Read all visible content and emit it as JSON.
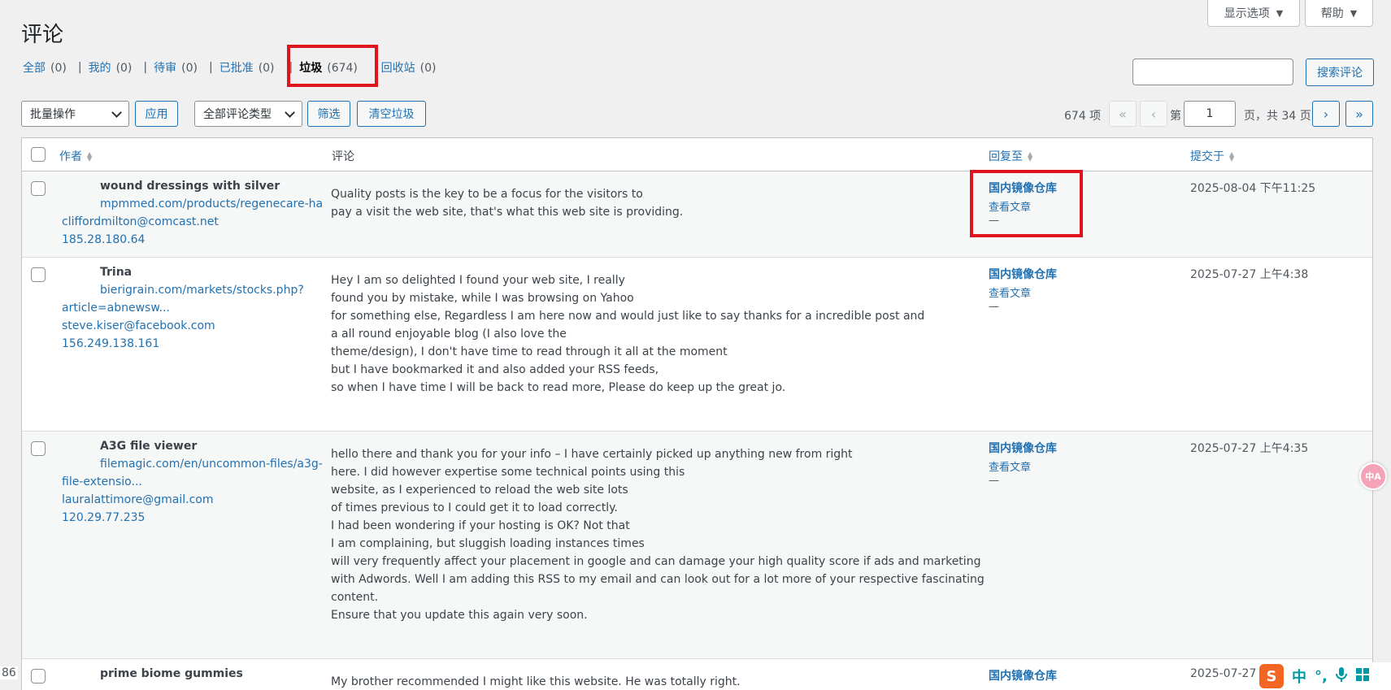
{
  "header": {
    "title": "评论",
    "screen_options": "显示选项",
    "help": "帮助"
  },
  "filters": [
    {
      "label": "全部",
      "count": "(0)"
    },
    {
      "label": "我的",
      "count": "(0)"
    },
    {
      "label": "待审",
      "count": "(0)"
    },
    {
      "label": "已批准",
      "count": "(0)"
    },
    {
      "label": "垃圾",
      "count": "(674)"
    },
    {
      "label": "回收站",
      "count": "(0)"
    }
  ],
  "search": {
    "value": "",
    "button": "搜索评论"
  },
  "tablenav": {
    "bulk_action": "批量操作",
    "apply": "应用",
    "comment_type": "全部评论类型",
    "filter": "筛选",
    "empty_spam": "清空垃圾",
    "items_count": "674 项",
    "first": "«",
    "prev": "‹",
    "page_prefix": "第",
    "current_page": "1",
    "page_suffix": "页，共 34 页",
    "next": "›",
    "last": "»"
  },
  "columns": {
    "author": "作者",
    "comment": "评论",
    "response": "回复至",
    "submitted": "提交于"
  },
  "rows": [
    {
      "author": "wound dressings with silver",
      "url": "mpmmed.com/products/regenecare-ha",
      "email": "cliffordmilton@comcast.net",
      "ip": "185.28.180.64",
      "comment": [
        "Quality posts is the key to be a focus for the visitors to",
        "pay a visit the web site, that's what this web site is providing."
      ],
      "response_title": "国内镜像仓库",
      "response_view": "查看文章",
      "response_dash": "—",
      "date": "2025-08-04 下午11:25"
    },
    {
      "author": "Trina",
      "url": "bierigrain.com/markets/stocks.php?",
      "url2": "article=abnewsw...",
      "email": "steve.kiser@facebook.com",
      "ip": "156.249.138.161",
      "comment": [
        "Hey I am so delighted I found your web site, I really",
        "found you by mistake, while I was browsing on Yahoo",
        "for something else, Regardless I am here now and would just like to say thanks for a incredible post and",
        "a all round enjoyable blog (I also love the",
        "theme/design), I don't have time to read through it all at the moment",
        "but I have bookmarked it and also added your RSS feeds,",
        "so when I have time I will be back to read more, Please do keep up the great jo."
      ],
      "response_title": "国内镜像仓库",
      "response_view": "查看文章",
      "response_dash": "—",
      "date": "2025-07-27 上午4:38"
    },
    {
      "author": "A3G file viewer",
      "url": "filemagic.com/en/uncommon-files/a3g-",
      "url2": "file-extensio...",
      "email": "lauralattimore@gmail.com",
      "ip": "120.29.77.235",
      "comment": [
        "hello there and thank you for your info – I have certainly picked up anything new from right",
        "here. I did however expertise some technical points using this",
        "website, as I experienced to reload the web site lots",
        "of times previous to I could get it to load correctly.",
        "I had been wondering if your hosting is OK? Not that",
        "I am complaining, but sluggish loading instances times",
        "will very frequently affect your placement in google and can damage your high quality score if ads and marketing",
        "with Adwords. Well I am adding this RSS to my email and can look out for a lot more of your respective fascinating",
        "content.",
        "Ensure that you update this again very soon."
      ],
      "response_title": "国内镜像仓库",
      "response_view": "查看文章",
      "response_dash": "—",
      "date": "2025-07-27 上午4:35"
    },
    {
      "author": "prime biome gummies",
      "comment": [
        "My brother recommended I might like this website. He was totally right."
      ],
      "response_title": "国内镜像仓库",
      "date": "2025-07-27"
    }
  ],
  "misc": {
    "left_number": "86",
    "badge": "中A",
    "ime": [
      "S",
      "中",
      "°,",
      "🎤",
      "⊞"
    ]
  }
}
